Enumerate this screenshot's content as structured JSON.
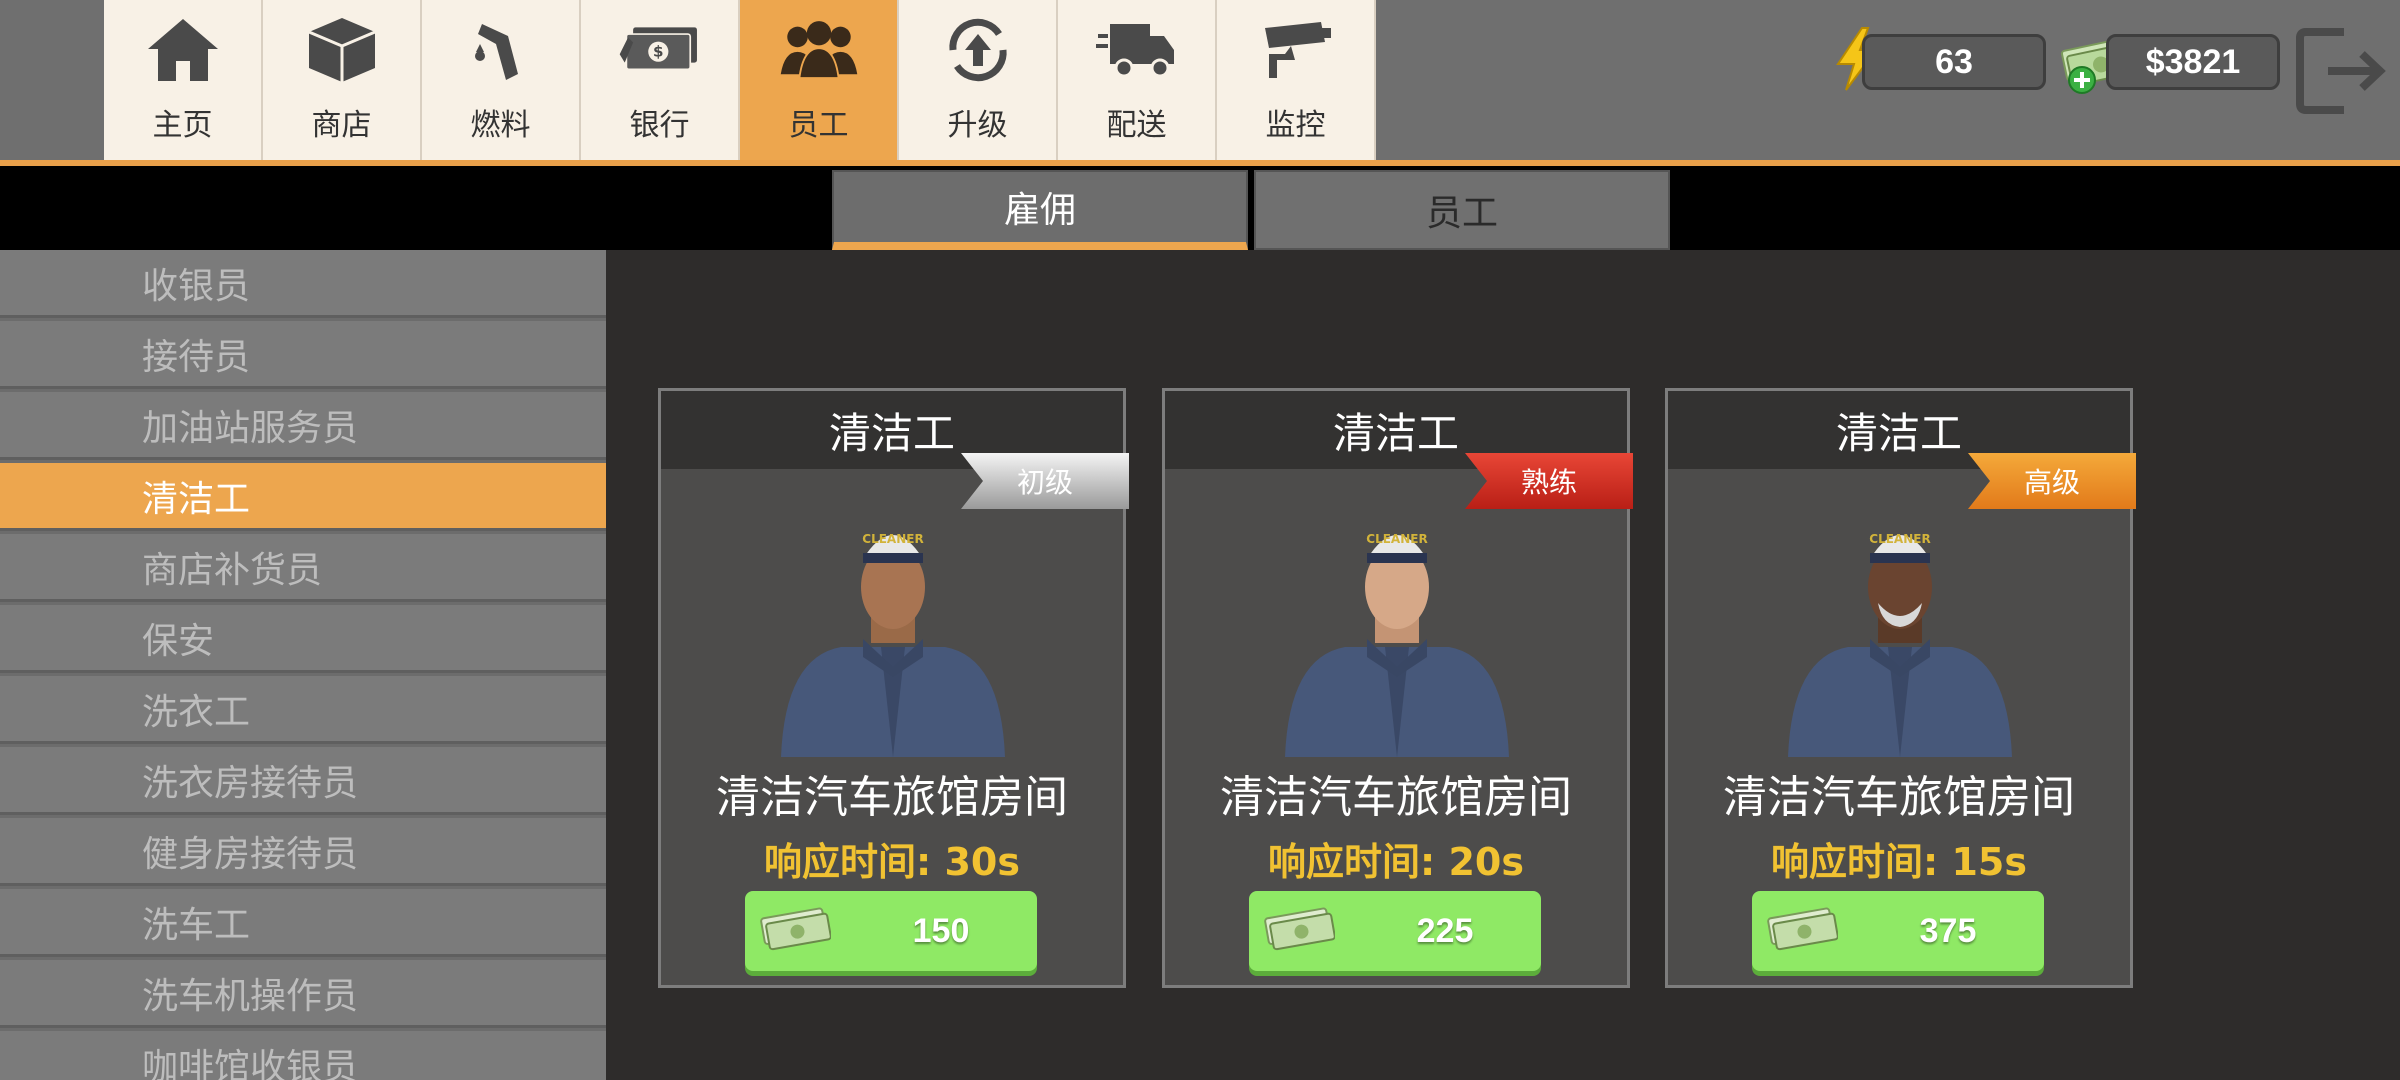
{
  "nav": {
    "tabs": [
      {
        "label": "主页",
        "icon": "home-icon"
      },
      {
        "label": "商店",
        "icon": "store-box-icon"
      },
      {
        "label": "燃料",
        "icon": "fuel-nozzle-icon"
      },
      {
        "label": "银行",
        "icon": "bank-money-icon"
      },
      {
        "label": "员工",
        "icon": "staff-group-icon",
        "active": true
      },
      {
        "label": "升级",
        "icon": "upgrade-icon"
      },
      {
        "label": "配送",
        "icon": "delivery-truck-icon"
      },
      {
        "label": "监控",
        "icon": "security-camera-icon"
      }
    ]
  },
  "resources": {
    "energy": "63",
    "money": "$3821"
  },
  "subtabs": {
    "hire": "雇佣",
    "staff": "员工"
  },
  "sidebar": {
    "items": [
      "收银员",
      "接待员",
      "加油站服务员",
      "清洁工",
      "商店补货员",
      "保安",
      "洗衣工",
      "洗衣房接待员",
      "健身房接待员",
      "洗车工",
      "洗车机操作员",
      "咖啡馆收银员"
    ],
    "active_index": 3
  },
  "cards": [
    {
      "title": "清洁工",
      "rank": "初级",
      "task": "清洁汽车旅馆房间",
      "time_label": "响应时间:",
      "time_value": "30s",
      "price": "150"
    },
    {
      "title": "清洁工",
      "rank": "熟练",
      "task": "清洁汽车旅馆房间",
      "time_label": "响应时间:",
      "time_value": "20s",
      "price": "225"
    },
    {
      "title": "清洁工",
      "rank": "高级",
      "task": "清洁汽车旅馆房间",
      "time_label": "响应时间:",
      "time_value": "15s",
      "price": "375"
    }
  ],
  "colors": {
    "accent": "#eda64e",
    "button_green": "#8fe965",
    "time_yellow": "#f1c232"
  }
}
